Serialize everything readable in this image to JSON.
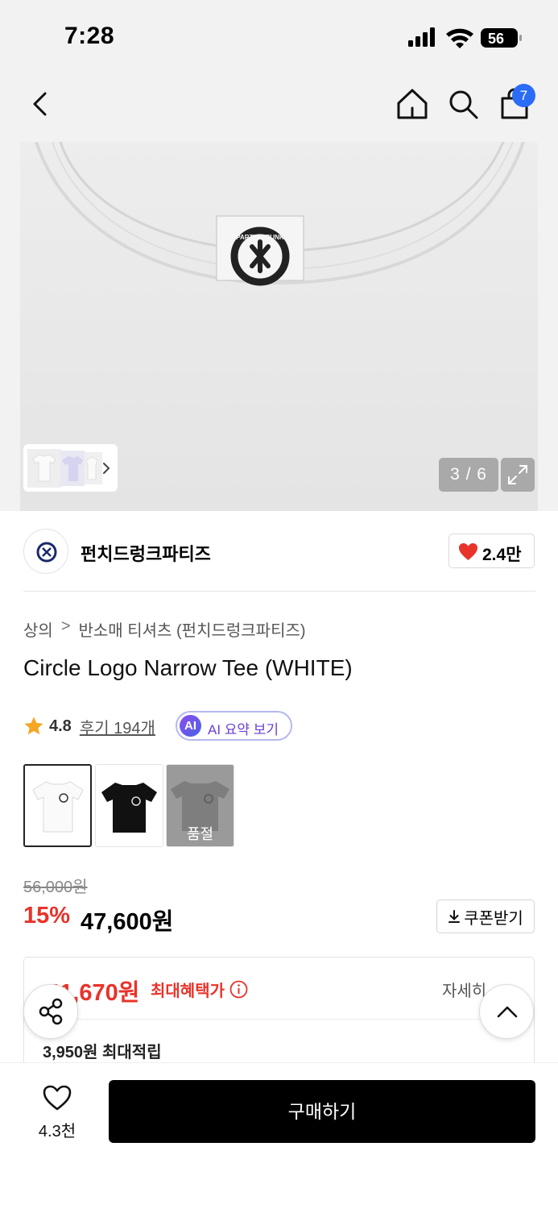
{
  "status_bar": {
    "time": "7:28",
    "battery": "56"
  },
  "nav": {
    "cart_badge": "7",
    "back_icon": "chevron-left-icon",
    "home_icon": "home-icon",
    "search_icon": "search-icon",
    "cart_icon": "shopping-bag-icon"
  },
  "gallery": {
    "counter": "3 / 6",
    "tag_text": "PARTIES·PUNK"
  },
  "brand": {
    "name": "펀치드렁크파티즈",
    "likes": "2.4만"
  },
  "breadcrumb": {
    "category": "상의",
    "separator": ">",
    "subcategory": "반소매 티셔츠 (펀치드렁크파티즈)"
  },
  "product": {
    "title": "Circle Logo Narrow Tee (WHITE)",
    "rating": "4.8",
    "reviews": "후기 194개",
    "ai_badge": "AI",
    "ai_label": "AI 요약 보기"
  },
  "variants": [
    {
      "color": "white",
      "label": ""
    },
    {
      "color": "black",
      "label": ""
    },
    {
      "color": "gray",
      "label": "품절"
    }
  ],
  "pricing": {
    "original": "56,000원",
    "discount": "15%",
    "price": "47,600원",
    "coupon_label": "쿠폰받기"
  },
  "benefits": {
    "max_price": "41,670원",
    "max_price_label": "최대혜택가",
    "detail_link": "자세히",
    "points": "3,950원 최대적립"
  },
  "bottom": {
    "wishlist_count": "4.3천",
    "buy_label": "구매하기"
  },
  "colors": {
    "accent_red": "#e8332a",
    "badge_blue": "#2b6cf6",
    "ai_purple": "#6b3fd6"
  }
}
